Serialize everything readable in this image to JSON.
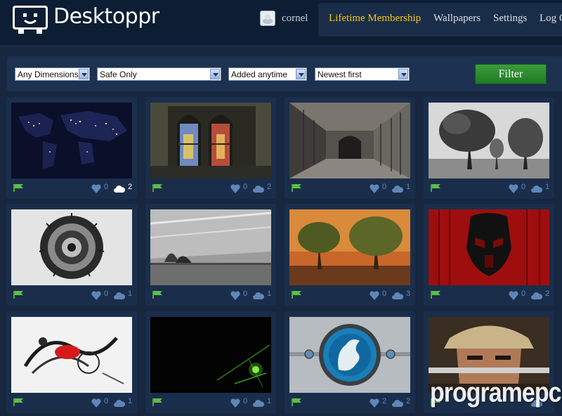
{
  "header": {
    "brand": "Desktoppr",
    "user": "cornel",
    "nav": [
      {
        "label": "Lifetime Membership",
        "highlight": true
      },
      {
        "label": "Wallpapers",
        "highlight": false
      },
      {
        "label": "Settings",
        "highlight": false
      },
      {
        "label": "Log O",
        "highlight": false
      }
    ]
  },
  "filters": {
    "dimensions": "Any Dimensions",
    "safety": "Safe Only",
    "added": "Added anytime",
    "sort": "Newest first",
    "button": "Filter"
  },
  "colors": {
    "background": "#16273f",
    "header": "#0d1d33",
    "accent_gold": "#f2c40f",
    "filter_green": "#2e8b34",
    "counter_blue": "#5f86b8"
  },
  "wallpapers": [
    {
      "subject": "world-at-night",
      "likes": "0",
      "saves": "2",
      "saved": true
    },
    {
      "subject": "stained-glass-window",
      "likes": "0",
      "saves": "2",
      "saved": false
    },
    {
      "subject": "cloister-corridor",
      "likes": "0",
      "saves": "1",
      "saved": false
    },
    {
      "subject": "bw-trees",
      "likes": "0",
      "saves": "1",
      "saved": false
    },
    {
      "subject": "tiny-planet",
      "likes": "0",
      "saves": "1",
      "saved": false
    },
    {
      "subject": "bw-sky-field",
      "likes": "0",
      "saves": "1",
      "saved": false
    },
    {
      "subject": "sunset-trees",
      "likes": "0",
      "saves": "3",
      "saved": false
    },
    {
      "subject": "red-stormtrooper",
      "likes": "0",
      "saves": "2",
      "saved": false
    },
    {
      "subject": "abstract-splash",
      "likes": "0",
      "saves": "1",
      "saved": false
    },
    {
      "subject": "green-light-dark",
      "likes": "0",
      "saves": "1",
      "saved": false
    },
    {
      "subject": "dragon-emblem",
      "likes": "2",
      "saves": "2",
      "saved": false
    },
    {
      "subject": "samurai-warrior",
      "likes": "",
      "saves": "",
      "saved": false
    }
  ],
  "watermark": "programepc.ro"
}
